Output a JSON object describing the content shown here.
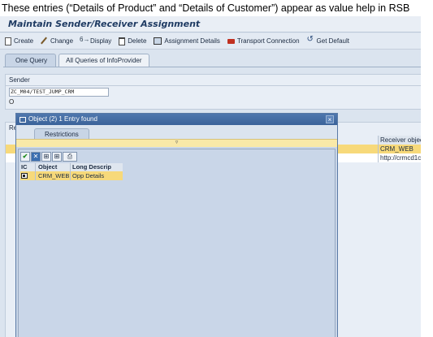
{
  "caption": "These entries (“Details of Product” and “Details of Customer”) appear as value help in RSB",
  "window": {
    "title": "Maintain Sender/Receiver Assignment"
  },
  "toolbar": {
    "create": "Create",
    "change": "Change",
    "display": "Display",
    "delete": "Delete",
    "assignment_details": "Assignment Details",
    "transport": "Transport Connection",
    "get_default": "Get Default"
  },
  "tabs": {
    "one_query": "One Query",
    "all_queries": "All Queries of InfoProvider"
  },
  "sender": {
    "label": "Sender",
    "value": "ZC_M04/TEST_JUMP_CRM",
    "second_line": "O"
  },
  "receiver": {
    "label": "Re",
    "column_header": "Receiver object",
    "rows": [
      "CRM_WEB",
      "http://crmcd1c"
    ]
  },
  "dialog": {
    "title": "Object (2)   1 Entry found",
    "close": "×",
    "tab_restrictions": "Restrictions",
    "collapse_glyph": "▿",
    "columns": {
      "ic": "IC",
      "object": "Object",
      "desc": "Long Descrip"
    },
    "rows": [
      {
        "object": "CRM_WEB",
        "desc": "Opp Details"
      }
    ]
  },
  "icons": {
    "accept": "check-icon",
    "cancel": "cancel-icon",
    "find": "find-icon",
    "find_next": "find-next-icon",
    "print": "print-icon"
  },
  "colors": {
    "selection": "#f7d97a",
    "dialog_title": "#4f77ad",
    "window_title_text": "#1f3b63"
  }
}
